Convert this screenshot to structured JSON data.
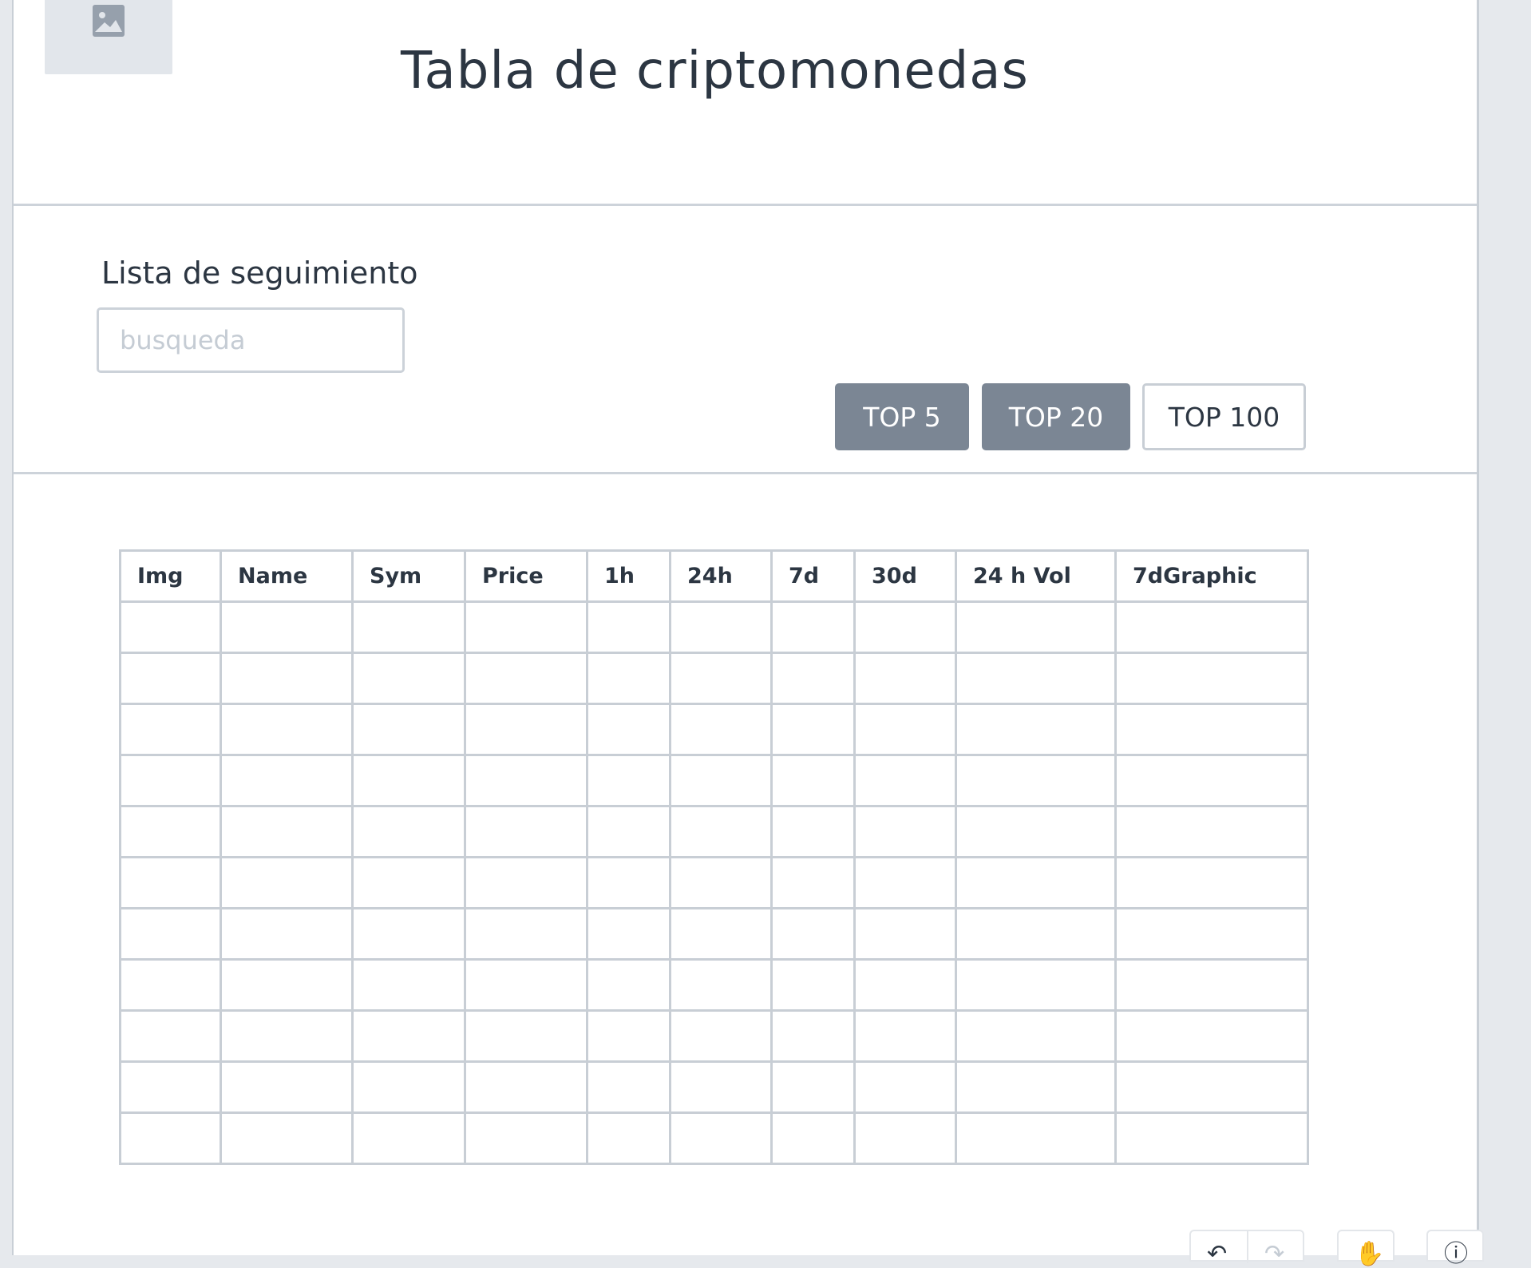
{
  "header": {
    "title": "Tabla de criptomonedas",
    "logo_icon": "image-placeholder-icon"
  },
  "watchlist": {
    "label": "Lista de seguimiento",
    "search_placeholder": "busqueda",
    "search_value": ""
  },
  "filters": [
    {
      "label": "TOP 5",
      "style": "filled"
    },
    {
      "label": "TOP 20",
      "style": "filled"
    },
    {
      "label": "TOP 100",
      "style": "outline"
    }
  ],
  "table": {
    "columns": [
      "Img",
      "Name",
      "Sym",
      "Price",
      "1h",
      "24h",
      "7d",
      "30d",
      "24 h Vol",
      "7dGraphic"
    ],
    "empty_rows": 11
  },
  "toolbar": {
    "icons": [
      "undo-icon",
      "redo-icon",
      "hand-icon",
      "info-icon"
    ]
  },
  "colors": {
    "text": "#2c3642",
    "border": "#c8ced5",
    "button_filled": "#7b8694",
    "background": "#ffffff"
  }
}
